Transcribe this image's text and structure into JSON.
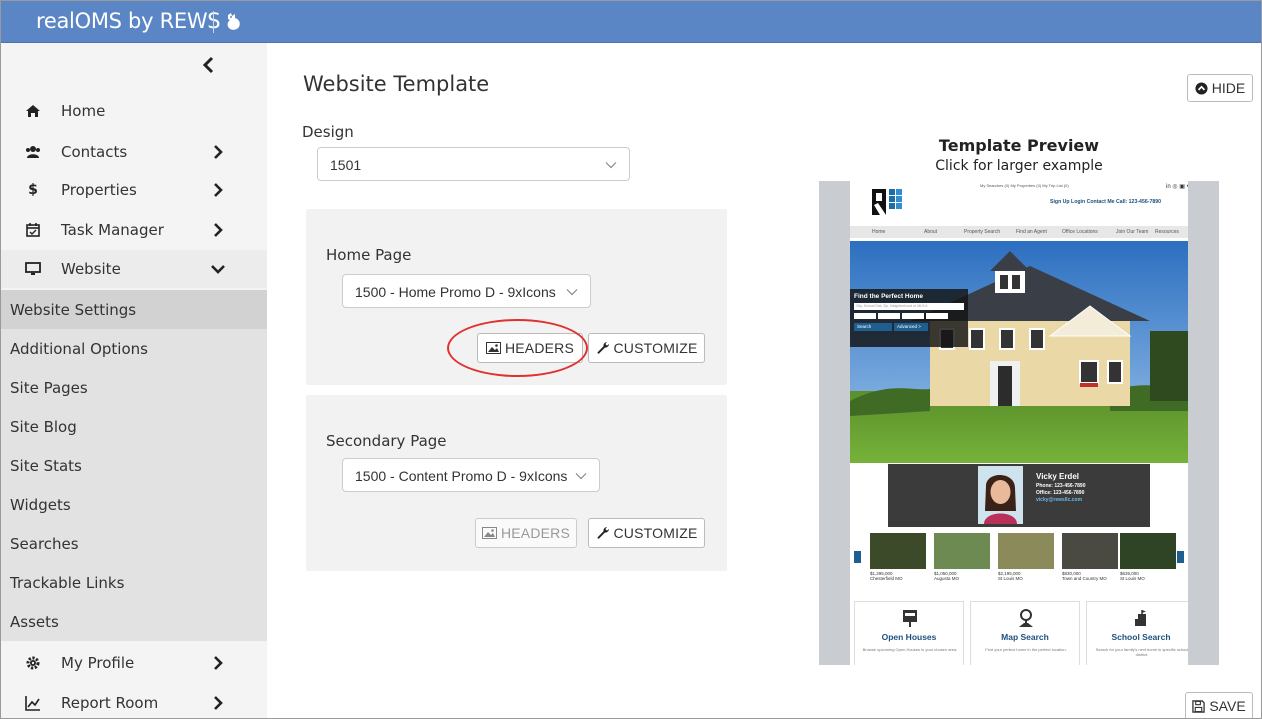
{
  "app": {
    "title": "realOMS by REWS"
  },
  "sidebar": {
    "items": [
      {
        "label": "Home",
        "icon": "home-icon"
      },
      {
        "label": "Contacts",
        "icon": "users-icon"
      },
      {
        "label": "Properties",
        "icon": "dollar-icon"
      },
      {
        "label": "Task Manager",
        "icon": "calendar-check-icon"
      },
      {
        "label": "Website",
        "icon": "monitor-icon"
      },
      {
        "label": "My Profile",
        "icon": "gear-icon"
      },
      {
        "label": "Report Room",
        "icon": "line-chart-icon"
      }
    ],
    "website_subitems": [
      "Website Settings",
      "Additional Options",
      "Site Pages",
      "Site Blog",
      "Site Stats",
      "Widgets",
      "Searches",
      "Trackable Links",
      "Assets"
    ],
    "selected_subitem": "Website Settings"
  },
  "main": {
    "title": "Website Template",
    "hide_label": "HIDE",
    "save_label": "SAVE",
    "design": {
      "label": "Design",
      "value": "1501"
    },
    "home_page": {
      "label": "Home Page",
      "value": "1500 - Home Promo D - 9xIcons",
      "headers_label": "HEADERS",
      "customize_label": "CUSTOMIZE"
    },
    "secondary_page": {
      "label": "Secondary Page",
      "value": "1500 - Content Promo D - 9xIcons",
      "headers_label": "HEADERS",
      "customize_label": "CUSTOMIZE"
    }
  },
  "preview": {
    "title": "Template Preview",
    "subtitle": "Click for larger example",
    "site": {
      "top_links": "My Searches (0)  My Properties (0)  My Trip List (0)",
      "account_links": "Sign Up   Login   Contact Me   Call: 123-456-7890",
      "nav": [
        "Home",
        "About",
        "Property Search",
        "Find an Agent",
        "Office Locations",
        "Join Our Team",
        "Resources"
      ],
      "search_heading": "Find the Perfect Home",
      "search_placeholder": "City, School Dist, Zip, Neighborhood or MLS #",
      "search_button": "Search",
      "advanced_button": "Advanced >",
      "agent_name": "Vicky Erdel",
      "agent_phone": "Phone: 123-456-7890",
      "agent_office": "Office: 123-456-7890",
      "agent_email": "vicky@rewsllc.com",
      "listings": [
        {
          "price": "$1,295,000",
          "city": "Chesterfield MO"
        },
        {
          "price": "$1,050,000",
          "city": "Augusta MO"
        },
        {
          "price": "$2,195,000",
          "city": "St Louis MO"
        },
        {
          "price": "$830,000",
          "city": "Town and Country MO"
        },
        {
          "price": "$635,000",
          "city": "St Louis MO"
        }
      ],
      "features": [
        {
          "title": "Open Houses",
          "desc": "Browse upcoming Open Houses in your chosen area."
        },
        {
          "title": "Map Search",
          "desc": "Find your perfect home in the perfect location."
        },
        {
          "title": "School Search",
          "desc": "Search for your family's next home in specific school district."
        }
      ]
    }
  }
}
